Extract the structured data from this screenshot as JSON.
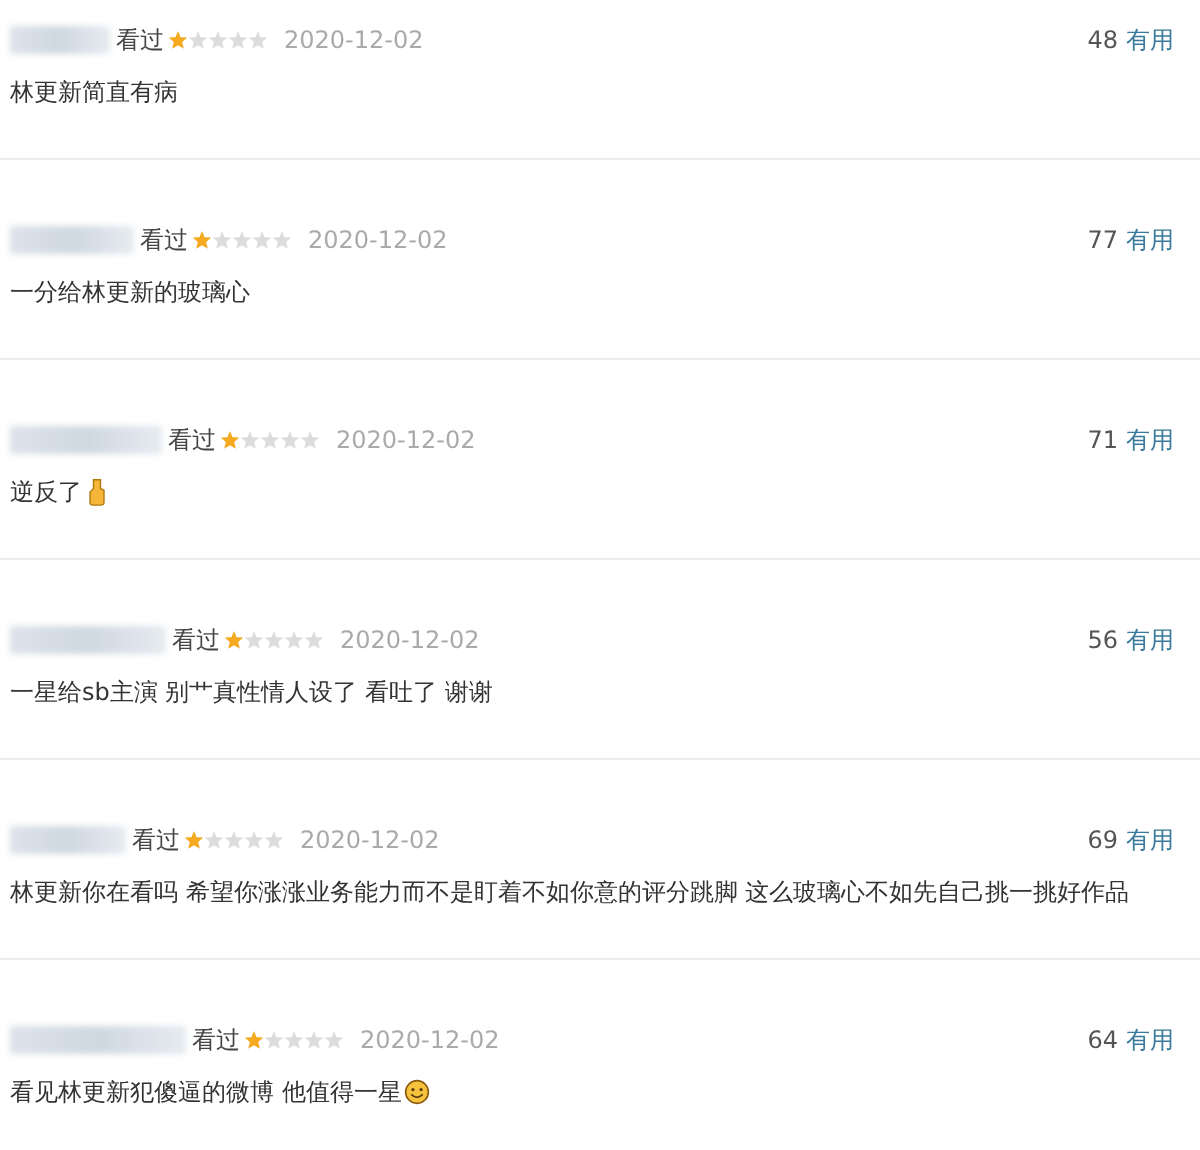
{
  "reviews": [
    {
      "kind": "plain",
      "status": "看过",
      "stars": 1,
      "date": "2020-12-02",
      "votes": "48",
      "vote_label": "有用",
      "comment": "林更新简直有病"
    },
    {
      "kind": "plain",
      "status": "看过",
      "stars": 1,
      "date": "2020-12-02",
      "votes": "77",
      "vote_label": "有用",
      "comment": "一分给林更新的玻璃心"
    },
    {
      "kind": "hand",
      "status": "看过",
      "stars": 1,
      "date": "2020-12-02",
      "votes": "71",
      "vote_label": "有用",
      "comment": "逆反了"
    },
    {
      "kind": "plain",
      "status": "看过",
      "stars": 1,
      "date": "2020-12-02",
      "votes": "56",
      "vote_label": "有用",
      "comment": "一星给sb主演 别艹真性情人设了 看吐了 谢谢"
    },
    {
      "kind": "plain",
      "status": "看过",
      "stars": 1,
      "date": "2020-12-02",
      "votes": "69",
      "vote_label": "有用",
      "comment": "林更新你在看吗 希望你涨涨业务能力而不是盯着不如你意的评分跳脚 这么玻璃心不如先自己挑一挑好作品"
    },
    {
      "kind": "smile",
      "status": "看过",
      "stars": 1,
      "date": "2020-12-02",
      "votes": "64",
      "vote_label": "有用",
      "comment": "看见林更新犯傻逼的微博 他值得一星"
    }
  ]
}
